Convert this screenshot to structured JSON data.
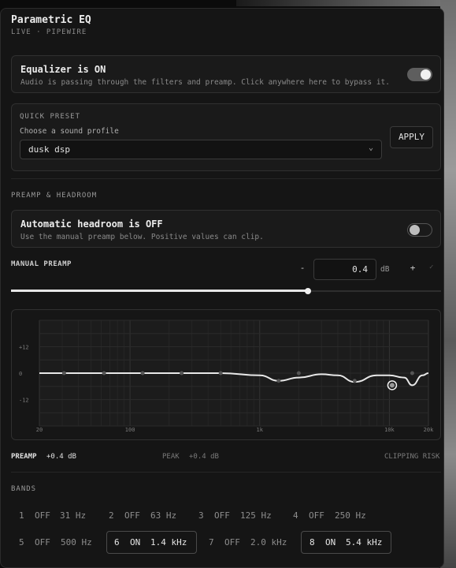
{
  "header": {
    "title": "Parametric EQ",
    "subtitle": "LIVE · PIPEWIRE"
  },
  "equalizer": {
    "title": "Equalizer is ON",
    "description": "Audio is passing through the filters and preamp. Click anywhere here to bypass it.",
    "enabled": true
  },
  "quick_preset": {
    "section_label": "QUICK PRESET",
    "field_label": "Choose a sound profile",
    "selected": "dusk dsp",
    "apply_label": "APPLY"
  },
  "preamp_section": {
    "label": "PREAMP & HEADROOM"
  },
  "headroom": {
    "title": "Automatic headroom is OFF",
    "description": "Use the manual preamp below. Positive values can clip.",
    "enabled": false
  },
  "manual_preamp": {
    "label": "MANUAL PREAMP",
    "minus_label": "-",
    "value": "0.4",
    "unit": "dB",
    "plus_label": "+",
    "confirm_icon": "check-icon",
    "slider_fraction": 0.69
  },
  "chart_data": {
    "type": "line",
    "x_scale": "log",
    "xlim": [
      20,
      20000
    ],
    "ylim": [
      -24,
      24
    ],
    "x_ticks": [
      "20",
      "100",
      "1k",
      "10k",
      "20k"
    ],
    "x_tick_values": [
      20,
      100,
      1000,
      10000,
      20000
    ],
    "y_ticks": [
      "+12",
      "0",
      "-12"
    ],
    "y_tick_values": [
      12,
      0,
      -12
    ],
    "grid": true,
    "series": [
      {
        "x": [
          20,
          31,
          63,
          125,
          250,
          500,
          1000,
          1400,
          2000,
          3000,
          4000,
          5400,
          8000,
          10000,
          13000,
          15000,
          18000,
          20000
        ],
        "y": [
          0,
          0,
          0,
          0,
          0,
          0,
          -1,
          -3.5,
          -2,
          -0.5,
          -1,
          -4,
          -1,
          -1,
          -2,
          -5.5,
          -1,
          0
        ]
      }
    ],
    "band_points": [
      {
        "x": 31,
        "y": 0
      },
      {
        "x": 63,
        "y": 0
      },
      {
        "x": 125,
        "y": 0
      },
      {
        "x": 250,
        "y": 0
      },
      {
        "x": 500,
        "y": 0
      },
      {
        "x": 1400,
        "y": -3.5
      },
      {
        "x": 2000,
        "y": 0
      },
      {
        "x": 5400,
        "y": -3.5
      },
      {
        "x": 15000,
        "y": 0
      }
    ],
    "selected_point": {
      "x": 10500,
      "y": -5.5
    }
  },
  "status": {
    "preamp_label": "PREAMP",
    "preamp_value": "+0.4 dB",
    "peak_label": "PEAK",
    "peak_value": "+0.4 dB",
    "clipping": "CLIPPING RISK"
  },
  "bands_section": {
    "label": "BANDS"
  },
  "bands": [
    {
      "index": "1",
      "state": "OFF",
      "freq": "31 Hz",
      "on": false
    },
    {
      "index": "2",
      "state": "OFF",
      "freq": "63 Hz",
      "on": false
    },
    {
      "index": "3",
      "state": "OFF",
      "freq": "125 Hz",
      "on": false
    },
    {
      "index": "4",
      "state": "OFF",
      "freq": "250 Hz",
      "on": false
    },
    {
      "index": "5",
      "state": "OFF",
      "freq": "500 Hz",
      "on": false
    },
    {
      "index": "6",
      "state": "ON",
      "freq": "1.4 kHz",
      "on": true
    },
    {
      "index": "7",
      "state": "OFF",
      "freq": "2.0 kHz",
      "on": false
    },
    {
      "index": "8",
      "state": "ON",
      "freq": "5.4 kHz",
      "on": true
    }
  ],
  "colors": {
    "panel": "#151515",
    "toggle_on": "#5e5e5e",
    "curve": "#e8e8e8",
    "muted_text": "#8a8a8a"
  }
}
